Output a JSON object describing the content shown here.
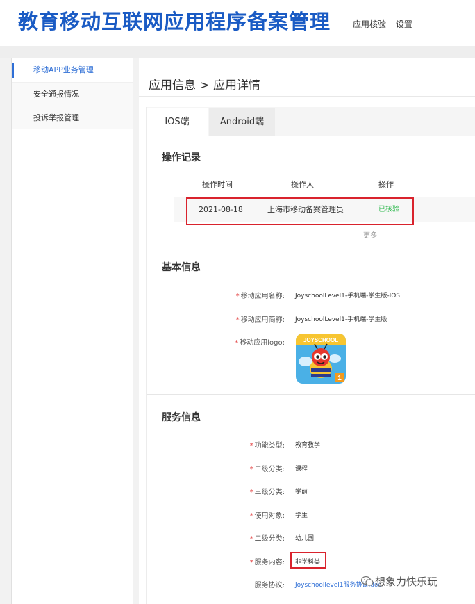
{
  "header": {
    "site_title": "教育移动互联网应用程序备案管理",
    "nav": [
      "应用核验",
      "设置"
    ]
  },
  "sidebar": {
    "items": [
      {
        "label": "移动APP业务管理"
      },
      {
        "label": "安全通报情况"
      },
      {
        "label": "投诉举报管理"
      }
    ]
  },
  "main": {
    "breadcrumb": "应用信息 > 应用详情",
    "tabs": [
      {
        "label": "IOS端"
      },
      {
        "label": "Android端"
      }
    ]
  },
  "operation_log": {
    "title": "操作记录",
    "columns": [
      "操作时间",
      "操作人",
      "操作"
    ],
    "rows": [
      {
        "time": "2021-08-18",
        "operator": "上海市移动备案管理员",
        "action": "已核验"
      }
    ],
    "more": "更多",
    "status_color": "#2db84d"
  },
  "basic_info": {
    "title": "基本信息",
    "fields": [
      {
        "label": "移动应用名称:",
        "value": "JoyschoolLevel1-手机端-学生版-IOS"
      },
      {
        "label": "移动应用简称:",
        "value": "JoyschoolLevel1-手机端-学生版"
      },
      {
        "label": "移动应用logo:",
        "value": ""
      }
    ],
    "logo": {
      "brand_text": "JOYSCHOOL",
      "badge_number": "1",
      "icon": "bee-mascot-icon"
    }
  },
  "service_info": {
    "title": "服务信息",
    "fields": [
      {
        "label": "功能类型:",
        "value": "教育教学"
      },
      {
        "label": "二级分类:",
        "value": "课程"
      },
      {
        "label": "三级分类:",
        "value": "学前"
      },
      {
        "label": "使用对象:",
        "value": "学生"
      },
      {
        "label": "二级分类:",
        "value": "幼儿园"
      },
      {
        "label": "服务内容:",
        "value": "非学科类"
      },
      {
        "label": "服务协议:",
        "value": "Joyschoollevel1服务协议.doc"
      }
    ]
  },
  "watermark": {
    "text": "想象力快乐玩",
    "icon": "wechat-official-account-icon"
  },
  "colors": {
    "brand": "#1a5bc4",
    "highlight_box": "#d9232d",
    "required": "#e23b3b",
    "link": "#2f6fd6"
  }
}
